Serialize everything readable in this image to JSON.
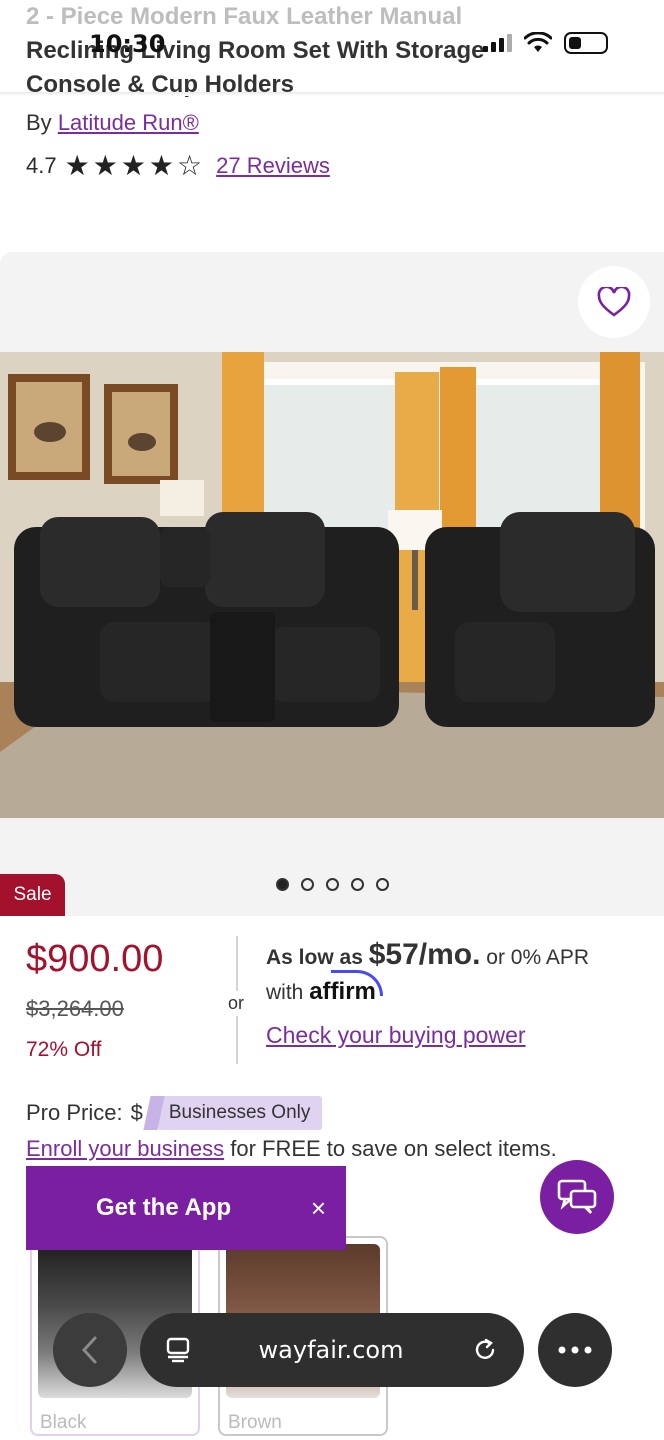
{
  "status_bar": {
    "time": "10:30"
  },
  "product": {
    "title_line1": "2 - Piece Modern Faux Leather Manual",
    "title_line2": "Reclining Living Room Set With Storage",
    "title_line3": "Console & Cup Holders",
    "by_label": "By",
    "brand": "Latitude Run®",
    "rating": "4.7",
    "stars": 4.7,
    "reviews_link": "27 Reviews"
  },
  "gallery": {
    "image_count": 5,
    "active_index": 0,
    "sale_badge": "Sale"
  },
  "pricing": {
    "price": "$900.00",
    "original_price": "$3,264.00",
    "discount": "72% Off",
    "or_label": "or",
    "as_low_as": "As low as",
    "monthly": "$57/mo.",
    "apr": "or 0% APR",
    "with_label": "with",
    "affirm": "affirm",
    "check_link": "Check your buying power"
  },
  "pro": {
    "label": "Pro Price:",
    "value_fragment": "$",
    "badge": "Businesses Only",
    "enroll_link": "Enroll your business",
    "enroll_text": "for FREE to save on select items."
  },
  "app_banner": {
    "label": "Get the App",
    "close": "×"
  },
  "swatches": [
    {
      "name": "Black"
    },
    {
      "name": "Brown"
    }
  ],
  "browser": {
    "url": "wayfair.com"
  },
  "colors": {
    "accent": "#7b1fa2",
    "sale": "#a3112d",
    "link": "#7b2c9e"
  }
}
